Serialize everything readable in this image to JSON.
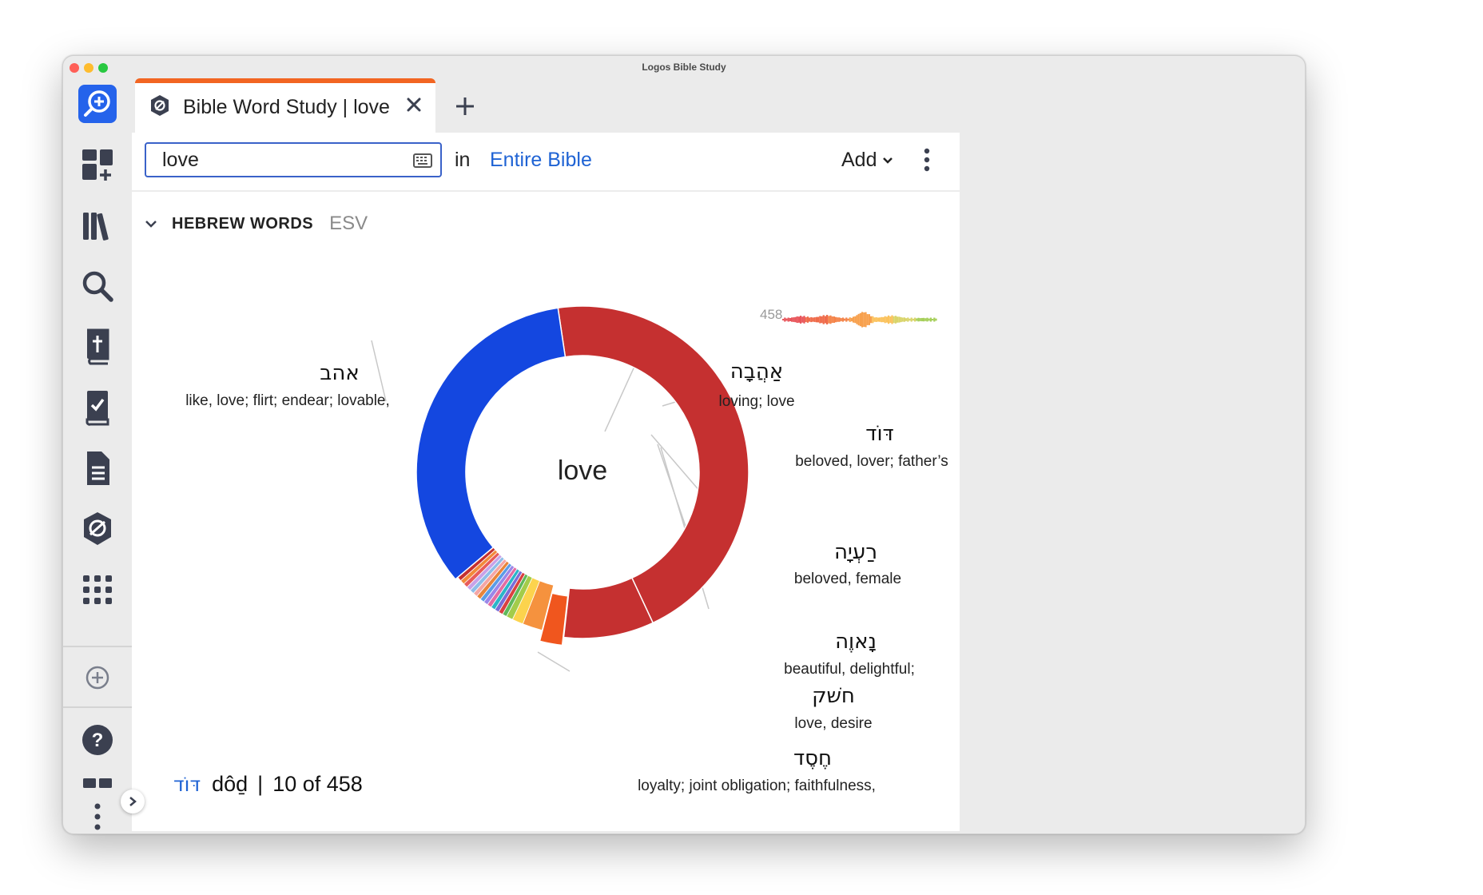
{
  "window": {
    "title": "Logos Bible Study",
    "traffic_lights": {
      "close": "#ff5f57",
      "minimize": "#febc2e",
      "zoom": "#28c840"
    }
  },
  "sidebar": {
    "items": [
      {
        "name": "search-home",
        "icon": "magnifier-plus-icon",
        "active": true
      },
      {
        "name": "layouts",
        "icon": "layout-grid-add-icon"
      },
      {
        "name": "library",
        "icon": "books-icon"
      },
      {
        "name": "search",
        "icon": "search-icon"
      },
      {
        "name": "bible",
        "icon": "bible-book-icon"
      },
      {
        "name": "reading-plan",
        "icon": "checklist-book-icon"
      },
      {
        "name": "documents",
        "icon": "document-icon"
      },
      {
        "name": "factbook",
        "icon": "factbook-shield-icon"
      },
      {
        "name": "tools",
        "icon": "apps-grid-icon"
      },
      {
        "name": "add",
        "icon": "plus-circle-icon"
      },
      {
        "name": "help",
        "icon": "help-icon"
      },
      {
        "name": "panels",
        "icon": "panels-icon"
      },
      {
        "name": "more",
        "icon": "more-vertical-icon"
      }
    ],
    "accent": "#2563eb"
  },
  "tabs": [
    {
      "title": "Bible Word Study | love",
      "accent": "#f26522"
    }
  ],
  "toolbar": {
    "search_value": "love",
    "in_label": "in",
    "range": "Entire Bible",
    "add_label": "Add"
  },
  "section": {
    "title": "HEBREW WORDS",
    "version": "ESV"
  },
  "spark": {
    "count": "458"
  },
  "chart_data": {
    "type": "pie",
    "center_label": "love",
    "total": 458,
    "slices": [
      {
        "lemma": "אהב",
        "gloss": "like, love; flirt; endear; lovable,",
        "value": 207,
        "color": "#c53030"
      },
      {
        "lemma": "אַהֲבָה",
        "gloss": "loving; love",
        "value": 40,
        "color": "#c53030"
      },
      {
        "lemma": "דּוֹד",
        "gloss": "beloved, lover; father’s",
        "value": 10,
        "color": "#f0561e"
      },
      {
        "lemma": "רַעְיָה",
        "gloss": "beloved, female",
        "value": 9,
        "color": "#f5923e"
      },
      {
        "value": 5,
        "color": "#fcd34d"
      },
      {
        "value": 3,
        "color": "#a3cc4a"
      },
      {
        "value": 2,
        "color": "#5fb85a"
      },
      {
        "value": 2,
        "color": "#d94141"
      },
      {
        "value": 2,
        "color": "#7b6cd8"
      },
      {
        "value": 2,
        "color": "#2bb5c9"
      },
      {
        "value": 2,
        "color": "#e36ca3"
      },
      {
        "lemma": "נָאוֶה",
        "gloss": "beautiful, delightful;",
        "value": 2,
        "color": "#9b87e8"
      },
      {
        "value": 2,
        "color": "#5b9ce6"
      },
      {
        "lemma": "חשׁק",
        "gloss": "love, desire",
        "value": 2,
        "color": "#e8853a"
      },
      {
        "value": 2,
        "color": "#f4a6a6"
      },
      {
        "value": 2,
        "color": "#8fbde8"
      },
      {
        "value": 2,
        "color": "#c8a2e8"
      },
      {
        "value": 2,
        "color": "#e85b5b"
      },
      {
        "value": 2,
        "color": "#f28a3b"
      },
      {
        "value": 2,
        "color": "#c53030"
      },
      {
        "lemma": "חֶסֶד",
        "gloss": "loyalty; joint obligation; faithfulness,",
        "value": 154,
        "color": "#1447e0"
      }
    ]
  },
  "footer": {
    "lemma": "דּוֹד",
    "transliteration": "dôḏ",
    "separator": "|",
    "position": "10 of 458"
  }
}
